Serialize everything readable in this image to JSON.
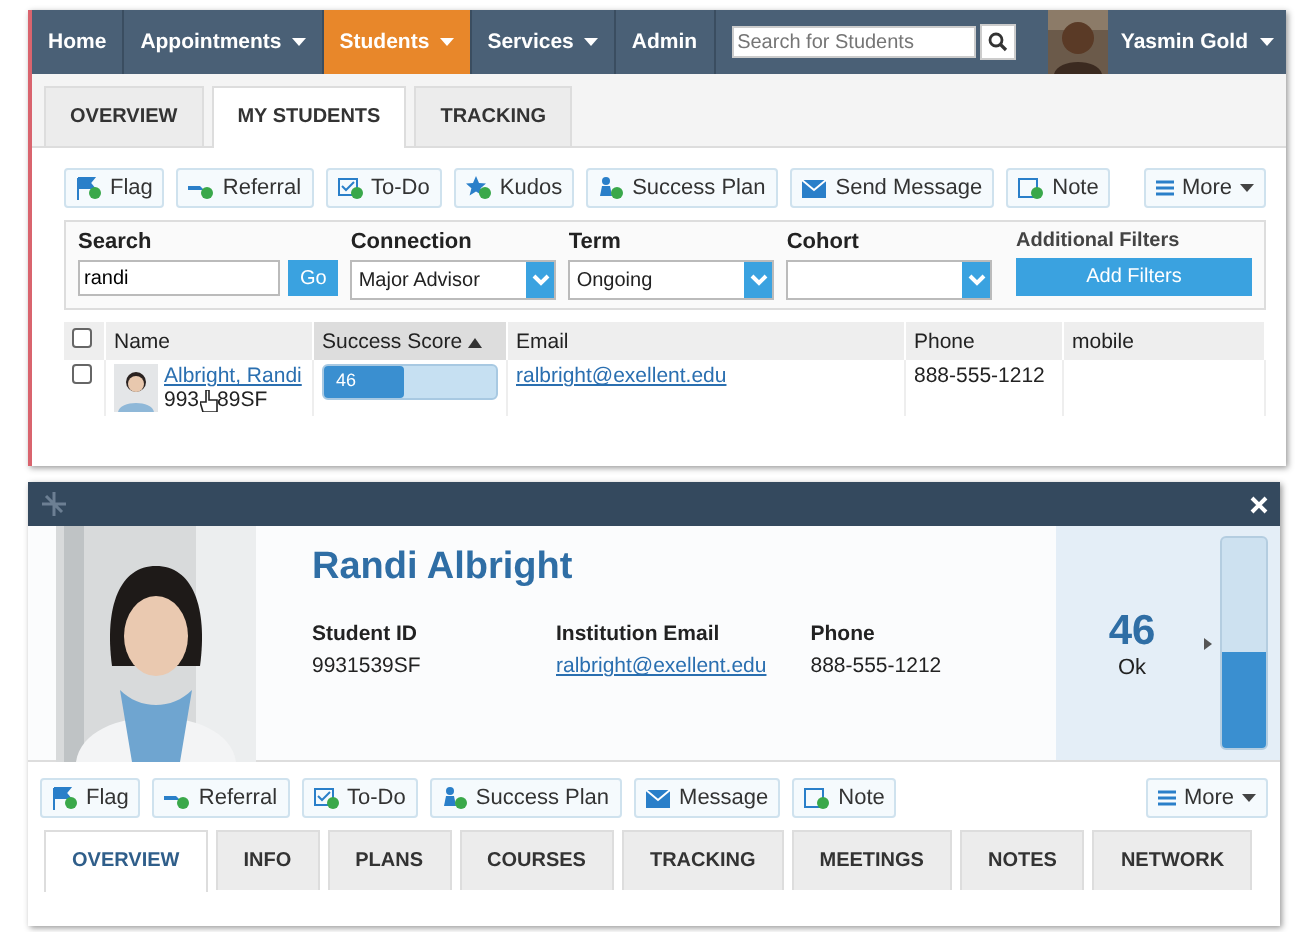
{
  "nav": {
    "items": [
      {
        "label": "Home",
        "dropdown": false,
        "selected": false
      },
      {
        "label": "Appointments",
        "dropdown": true,
        "selected": false
      },
      {
        "label": "Students",
        "dropdown": true,
        "selected": true
      },
      {
        "label": "Services",
        "dropdown": true,
        "selected": false
      },
      {
        "label": "Admin",
        "dropdown": false,
        "selected": false
      }
    ],
    "search": {
      "placeholder": "Search for Students"
    },
    "user": "Yasmin Gold"
  },
  "tabs": [
    {
      "label": "OVERVIEW",
      "selected": false
    },
    {
      "label": "MY STUDENTS",
      "selected": true
    },
    {
      "label": "TRACKING",
      "selected": false
    }
  ],
  "actions": [
    {
      "kind": "flag",
      "label": "Flag"
    },
    {
      "kind": "referral",
      "label": "Referral"
    },
    {
      "kind": "todo",
      "label": "To-Do"
    },
    {
      "kind": "kudos",
      "label": "Kudos"
    },
    {
      "kind": "plan",
      "label": "Success Plan"
    },
    {
      "kind": "message",
      "label": "Send Message"
    },
    {
      "kind": "note",
      "label": "Note"
    }
  ],
  "more": "More",
  "filters": {
    "search": {
      "label": "Search",
      "value": "randi",
      "button": "Go"
    },
    "selects": [
      {
        "label": "Connection",
        "value": "Major Advisor"
      },
      {
        "label": "Term",
        "value": "Ongoing"
      },
      {
        "label": "Cohort"
      }
    ],
    "additional": {
      "label": "Additional Filters",
      "button": "Add Filters"
    }
  },
  "table": {
    "columns": [
      {
        "label": "Name",
        "sorted": false
      },
      {
        "label": "Success Score",
        "sorted": true
      },
      {
        "label": "Email",
        "sorted": false
      },
      {
        "label": "Phone",
        "sorted": false
      },
      {
        "label": "mobile",
        "sorted": false
      }
    ],
    "all_checked": false,
    "rows": [
      {
        "checked": false,
        "name": "Albright, Randi",
        "id_parts": [
          "993",
          "89SF"
        ],
        "score": "46",
        "level": 0.46,
        "email": "ralbright@exellent.edu",
        "phone": "888-555-1212"
      }
    ]
  },
  "profile": {
    "name": "Randi Albright",
    "fields": [
      {
        "kind": "text",
        "label": "Student ID",
        "value": "9931539SF"
      },
      {
        "kind": "link",
        "label": "Institution Email",
        "value": "ralbright@exellent.edu"
      },
      {
        "kind": "text",
        "label": "Phone",
        "value": "888-555-1212"
      }
    ],
    "score": "46",
    "score_label": "Ok",
    "level": 0.46,
    "actions": [
      {
        "kind": "flag",
        "label": "Flag"
      },
      {
        "kind": "referral",
        "label": "Referral"
      },
      {
        "kind": "todo",
        "label": "To-Do"
      },
      {
        "kind": "plan",
        "label": "Success Plan"
      },
      {
        "kind": "message",
        "label": "Message"
      },
      {
        "kind": "note",
        "label": "Note"
      }
    ],
    "more": "More",
    "tabs": [
      {
        "label": "OVERVIEW",
        "selected": true
      },
      {
        "label": "INFO",
        "selected": false
      },
      {
        "label": "PLANS",
        "selected": false
      },
      {
        "label": "COURSES",
        "selected": false
      },
      {
        "label": "TRACKING",
        "selected": false
      },
      {
        "label": "MEETINGS",
        "selected": false
      },
      {
        "label": "NOTES",
        "selected": false
      },
      {
        "label": "NETWORK",
        "selected": false
      }
    ]
  }
}
